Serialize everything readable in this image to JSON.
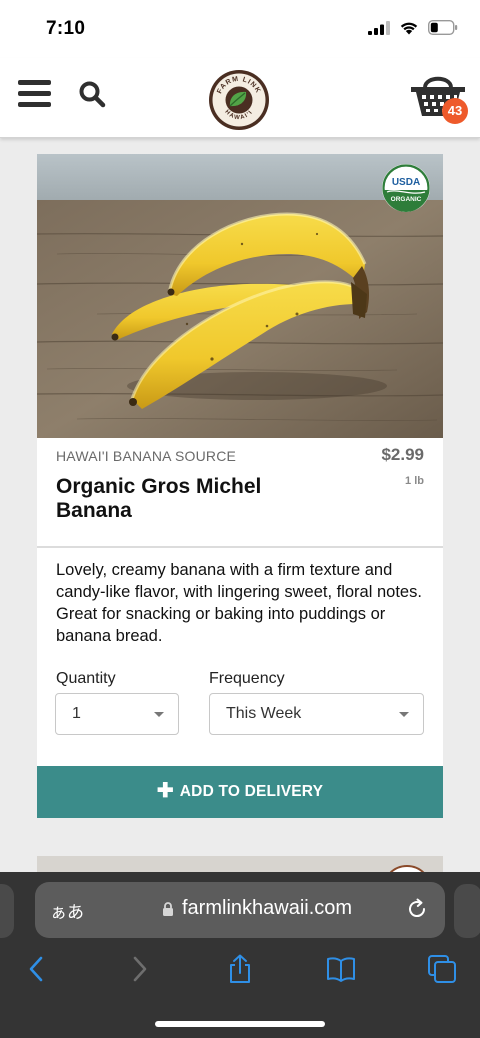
{
  "status_bar": {
    "time": "7:10",
    "icons": [
      "signal-icon",
      "wifi-icon",
      "battery-icon"
    ]
  },
  "header": {
    "menu_icon": "hamburger-menu-icon",
    "search_icon": "search-icon",
    "logo": {
      "top_text": "FARM LINK",
      "bottom_text": "HAWAI'I"
    },
    "cart_icon": "shopping-basket-icon",
    "cart_count": "43"
  },
  "product": {
    "badge": {
      "line1": "USDA",
      "line2": "ORGANIC"
    },
    "vendor": "HAWAI'I BANANA SOURCE",
    "price": "$2.99",
    "unit": "1 lb",
    "name": "Organic Gros Michel Banana",
    "description": "Lovely, creamy banana with a firm texture and candy-like flavor, with lingering sweet, floral notes.  Great for snacking or baking into puddings or banana bread.",
    "quantity_label": "Quantity",
    "quantity_value": "1",
    "frequency_label": "Frequency",
    "frequency_value": "This Week",
    "add_button_label": "ADD TO DELIVERY"
  },
  "browser": {
    "aa_label": "ぁあ",
    "url": "farmlinkhawaii.com",
    "toolbar_icons": [
      "back-icon",
      "forward-icon",
      "share-icon",
      "bookmarks-icon",
      "tabs-icon"
    ]
  },
  "colors": {
    "accent_button": "#3b8c8a",
    "cart_badge": "#ee5a2b",
    "logo_brown": "#4a2e22",
    "logo_green": "#3f8a3a",
    "banana_yellow": "#f0c930"
  }
}
